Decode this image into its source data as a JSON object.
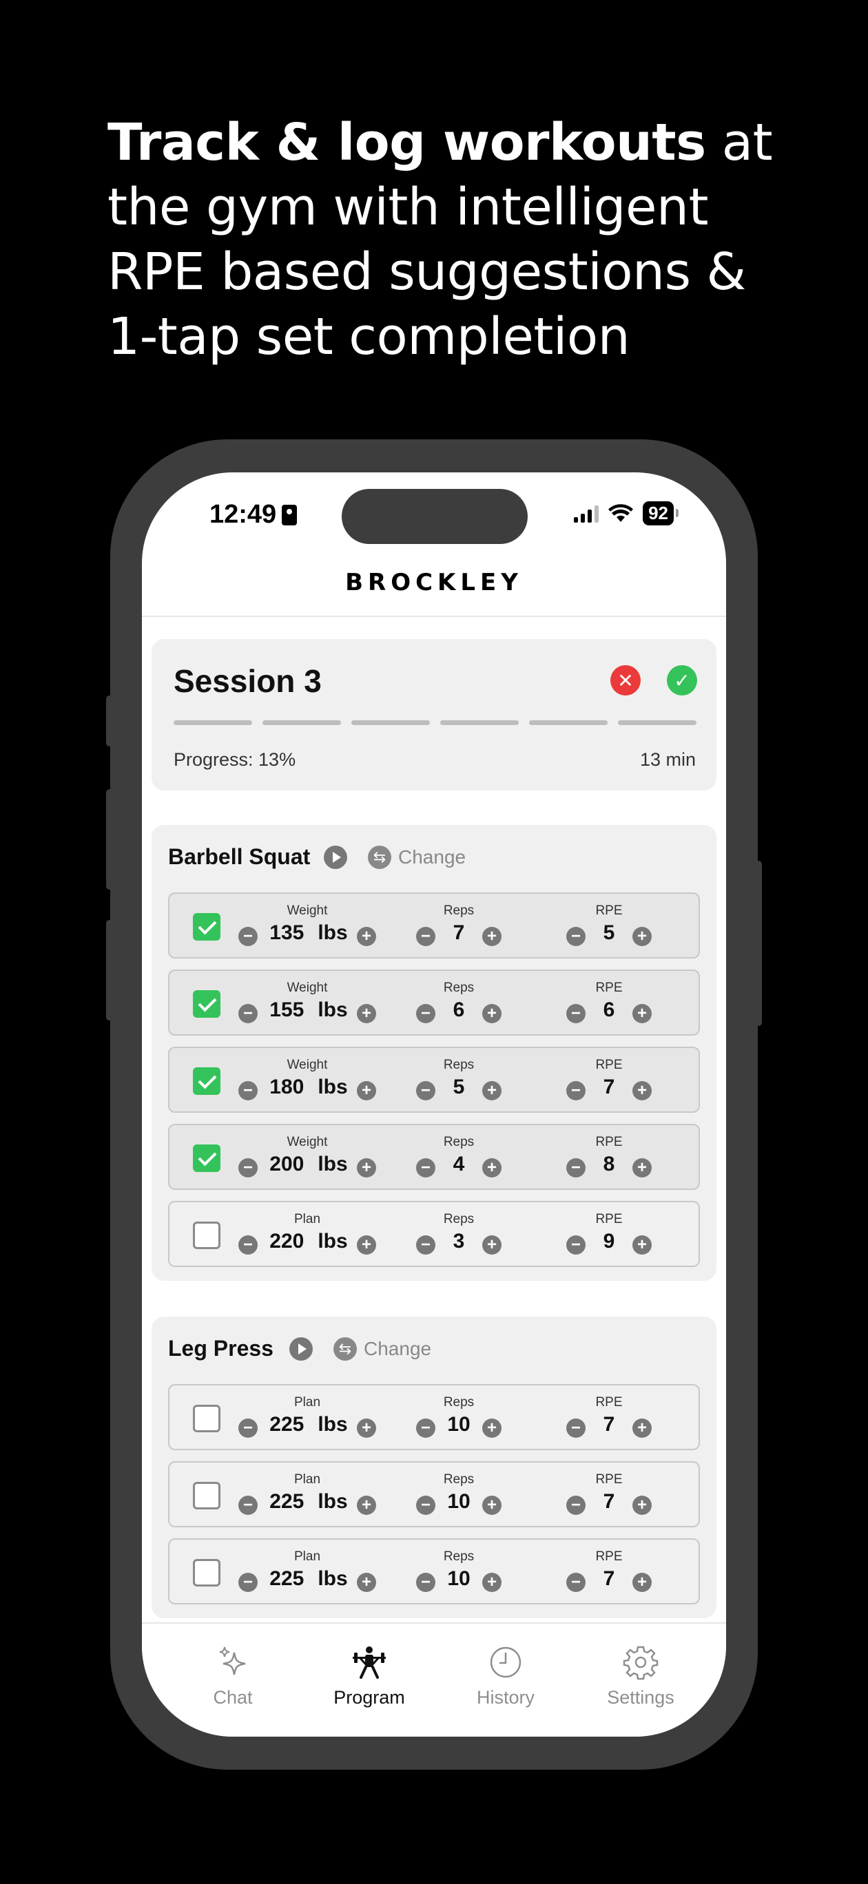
{
  "headline": {
    "bold": "Track & log workouts",
    "rest": " at the gym with intelligent RPE based suggestions & 1-tap set completion"
  },
  "status_bar": {
    "time": "12:49",
    "battery": "92"
  },
  "app": {
    "brand": "BROCKLEY"
  },
  "session": {
    "title": "Session 3",
    "progress_label": "Progress: 13%",
    "progress_value": 0.13,
    "segments": 6,
    "duration": "13 min"
  },
  "exercises": [
    {
      "name": "Barbell Squat",
      "change_label": "Change",
      "sets": [
        {
          "completed": true,
          "weight_label": "Weight",
          "weight": "135",
          "unit": "lbs",
          "reps_label": "Reps",
          "reps": "7",
          "rpe_label": "RPE",
          "rpe": "5"
        },
        {
          "completed": true,
          "weight_label": "Weight",
          "weight": "155",
          "unit": "lbs",
          "reps_label": "Reps",
          "reps": "6",
          "rpe_label": "RPE",
          "rpe": "6"
        },
        {
          "completed": true,
          "weight_label": "Weight",
          "weight": "180",
          "unit": "lbs",
          "reps_label": "Reps",
          "reps": "5",
          "rpe_label": "RPE",
          "rpe": "7"
        },
        {
          "completed": true,
          "weight_label": "Weight",
          "weight": "200",
          "unit": "lbs",
          "reps_label": "Reps",
          "reps": "4",
          "rpe_label": "RPE",
          "rpe": "8"
        },
        {
          "completed": false,
          "weight_label": "Plan",
          "weight": "220",
          "unit": "lbs",
          "reps_label": "Reps",
          "reps": "3",
          "rpe_label": "RPE",
          "rpe": "9"
        }
      ]
    },
    {
      "name": "Leg Press",
      "change_label": "Change",
      "sets": [
        {
          "completed": false,
          "weight_label": "Plan",
          "weight": "225",
          "unit": "lbs",
          "reps_label": "Reps",
          "reps": "10",
          "rpe_label": "RPE",
          "rpe": "7"
        },
        {
          "completed": false,
          "weight_label": "Plan",
          "weight": "225",
          "unit": "lbs",
          "reps_label": "Reps",
          "reps": "10",
          "rpe_label": "RPE",
          "rpe": "7"
        },
        {
          "completed": false,
          "weight_label": "Plan",
          "weight": "225",
          "unit": "lbs",
          "reps_label": "Reps",
          "reps": "10",
          "rpe_label": "RPE",
          "rpe": "7"
        }
      ]
    }
  ],
  "tabs": [
    {
      "label": "Chat",
      "icon": "sparkle-icon",
      "active": false
    },
    {
      "label": "Program",
      "icon": "weightlifter-icon",
      "active": true
    },
    {
      "label": "History",
      "icon": "clock-icon",
      "active": false
    },
    {
      "label": "Settings",
      "icon": "gear-icon",
      "active": false
    }
  ],
  "colors": {
    "check_green": "#34c35a",
    "cancel_red": "#ec3a3a",
    "frame": "#3d3d3d"
  }
}
